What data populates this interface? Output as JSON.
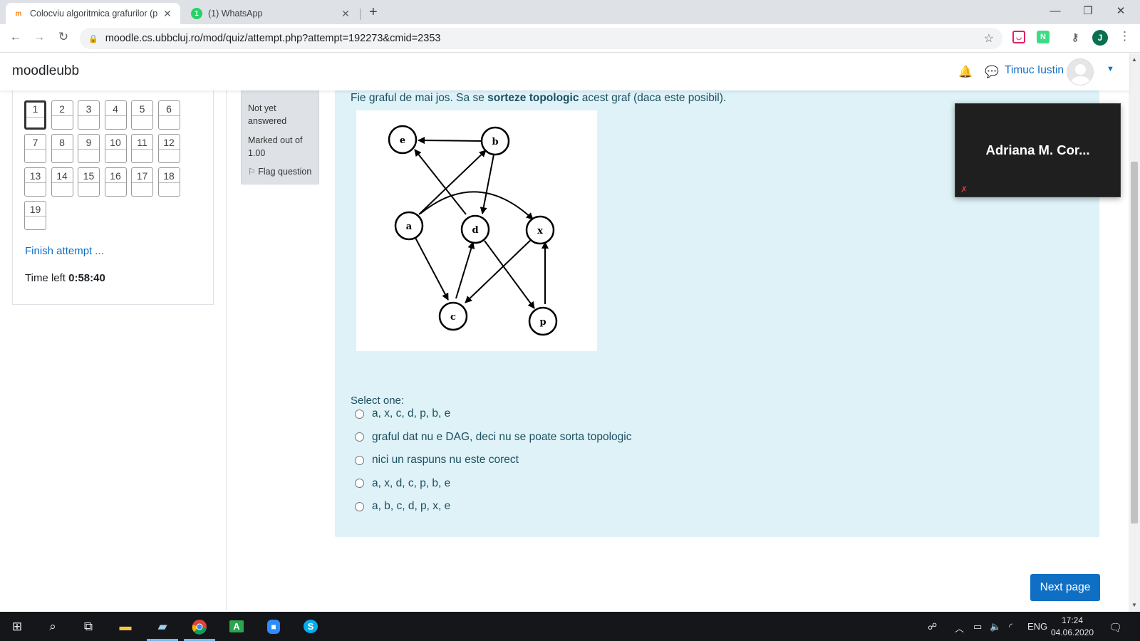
{
  "browser": {
    "tabs": [
      {
        "title": "Colocviu algoritmica grafurilor (p",
        "favicon": "moodle-icon"
      },
      {
        "title": "(1) WhatsApp",
        "favicon": "whatsapp-icon"
      }
    ],
    "url": "moodle.cs.ubbcluj.ro/mod/quiz/attempt.php?attempt=192273&cmid=2353",
    "profile_initial": "J"
  },
  "header": {
    "brand": "moodleubb",
    "user_name": "Timuc Iustin"
  },
  "quiz_nav": {
    "question_numbers": [
      "1",
      "2",
      "3",
      "4",
      "5",
      "6",
      "7",
      "8",
      "9",
      "10",
      "11",
      "12",
      "13",
      "14",
      "15",
      "16",
      "17",
      "18",
      "19"
    ],
    "current": "1",
    "finish_label": "Finish attempt ...",
    "time_left_label": "Time left",
    "time_left_value": "0:58:40"
  },
  "question_info": {
    "state": "Not yet answered",
    "grade": "Marked out of 1.00",
    "flag_label": "Flag question"
  },
  "question": {
    "text_before": "Fie graful de mai jos. Sa se ",
    "text_bold": "sorteze topologic",
    "text_after": " acest graf (daca este posibil).",
    "graph": {
      "nodes": [
        "e",
        "b",
        "a",
        "d",
        "x",
        "c",
        "p"
      ],
      "edges": [
        [
          "b",
          "e"
        ],
        [
          "a",
          "b"
        ],
        [
          "d",
          "e"
        ],
        [
          "b",
          "d"
        ],
        [
          "a",
          "x"
        ],
        [
          "a",
          "c"
        ],
        [
          "c",
          "d"
        ],
        [
          "d",
          "p"
        ],
        [
          "x",
          "c"
        ],
        [
          "p",
          "x"
        ]
      ]
    },
    "prompt": "Select one:",
    "options": [
      "a, x, c, d, p, b, e",
      "graful dat nu e DAG, deci nu se poate sorta topologic",
      "nici un raspuns nu este corect",
      "a, x, d, c, p, b, e",
      "a, b, c, d, p, x, e"
    ]
  },
  "next_button": "Next page",
  "video_tile": {
    "name": "Adriana M. Cor..."
  },
  "taskbar": {
    "language": "ENG",
    "time": "17:24",
    "date": "04.06.2020"
  },
  "colors": {
    "accent": "#0f6fc5",
    "question_bg": "#def2f8",
    "info_bg": "#dee2e6"
  }
}
